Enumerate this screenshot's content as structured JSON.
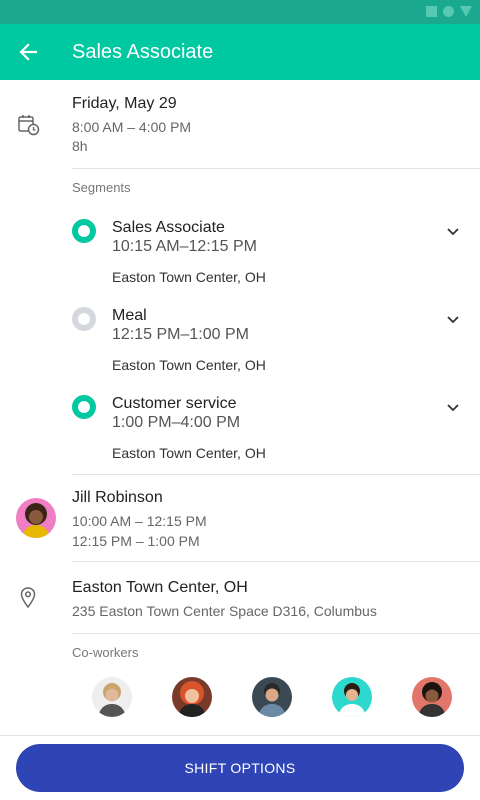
{
  "app_bar": {
    "title": "Sales Associate"
  },
  "shift": {
    "date": "Friday, May 29",
    "hours": "8:00 AM – 4:00 PM",
    "duration": "8h"
  },
  "segments_label": "Segments",
  "segments": [
    {
      "name": "Sales Associate",
      "time": "10:15 AM–12:15 PM",
      "location": "Easton Town Center, OH",
      "status": "active"
    },
    {
      "name": "Meal",
      "time": "12:15 PM–1:00 PM",
      "location": "Easton Town Center, OH",
      "status": "inactive"
    },
    {
      "name": "Customer service",
      "time": "1:00 PM–4:00 PM",
      "location": "Easton Town Center, OH",
      "status": "active"
    }
  ],
  "manager": {
    "name": "Jill Robinson",
    "time1": "10:00 AM – 12:15 PM",
    "time2": "12:15 PM – 1:00 PM"
  },
  "location": {
    "name": "Easton Town Center, OH",
    "address": "235 Easton Town Center Space D316, Columbus"
  },
  "coworkers_label": "Co-workers",
  "bottom": {
    "button_label": "SHIFT OPTIONS"
  },
  "colors": {
    "accent": "#00c8a0",
    "statusbar": "#1aa98e",
    "button": "#2f45b5"
  },
  "icons": [
    "arrow-back-icon",
    "calendar-clock-icon",
    "chevron-down-icon",
    "location-pin-icon"
  ]
}
